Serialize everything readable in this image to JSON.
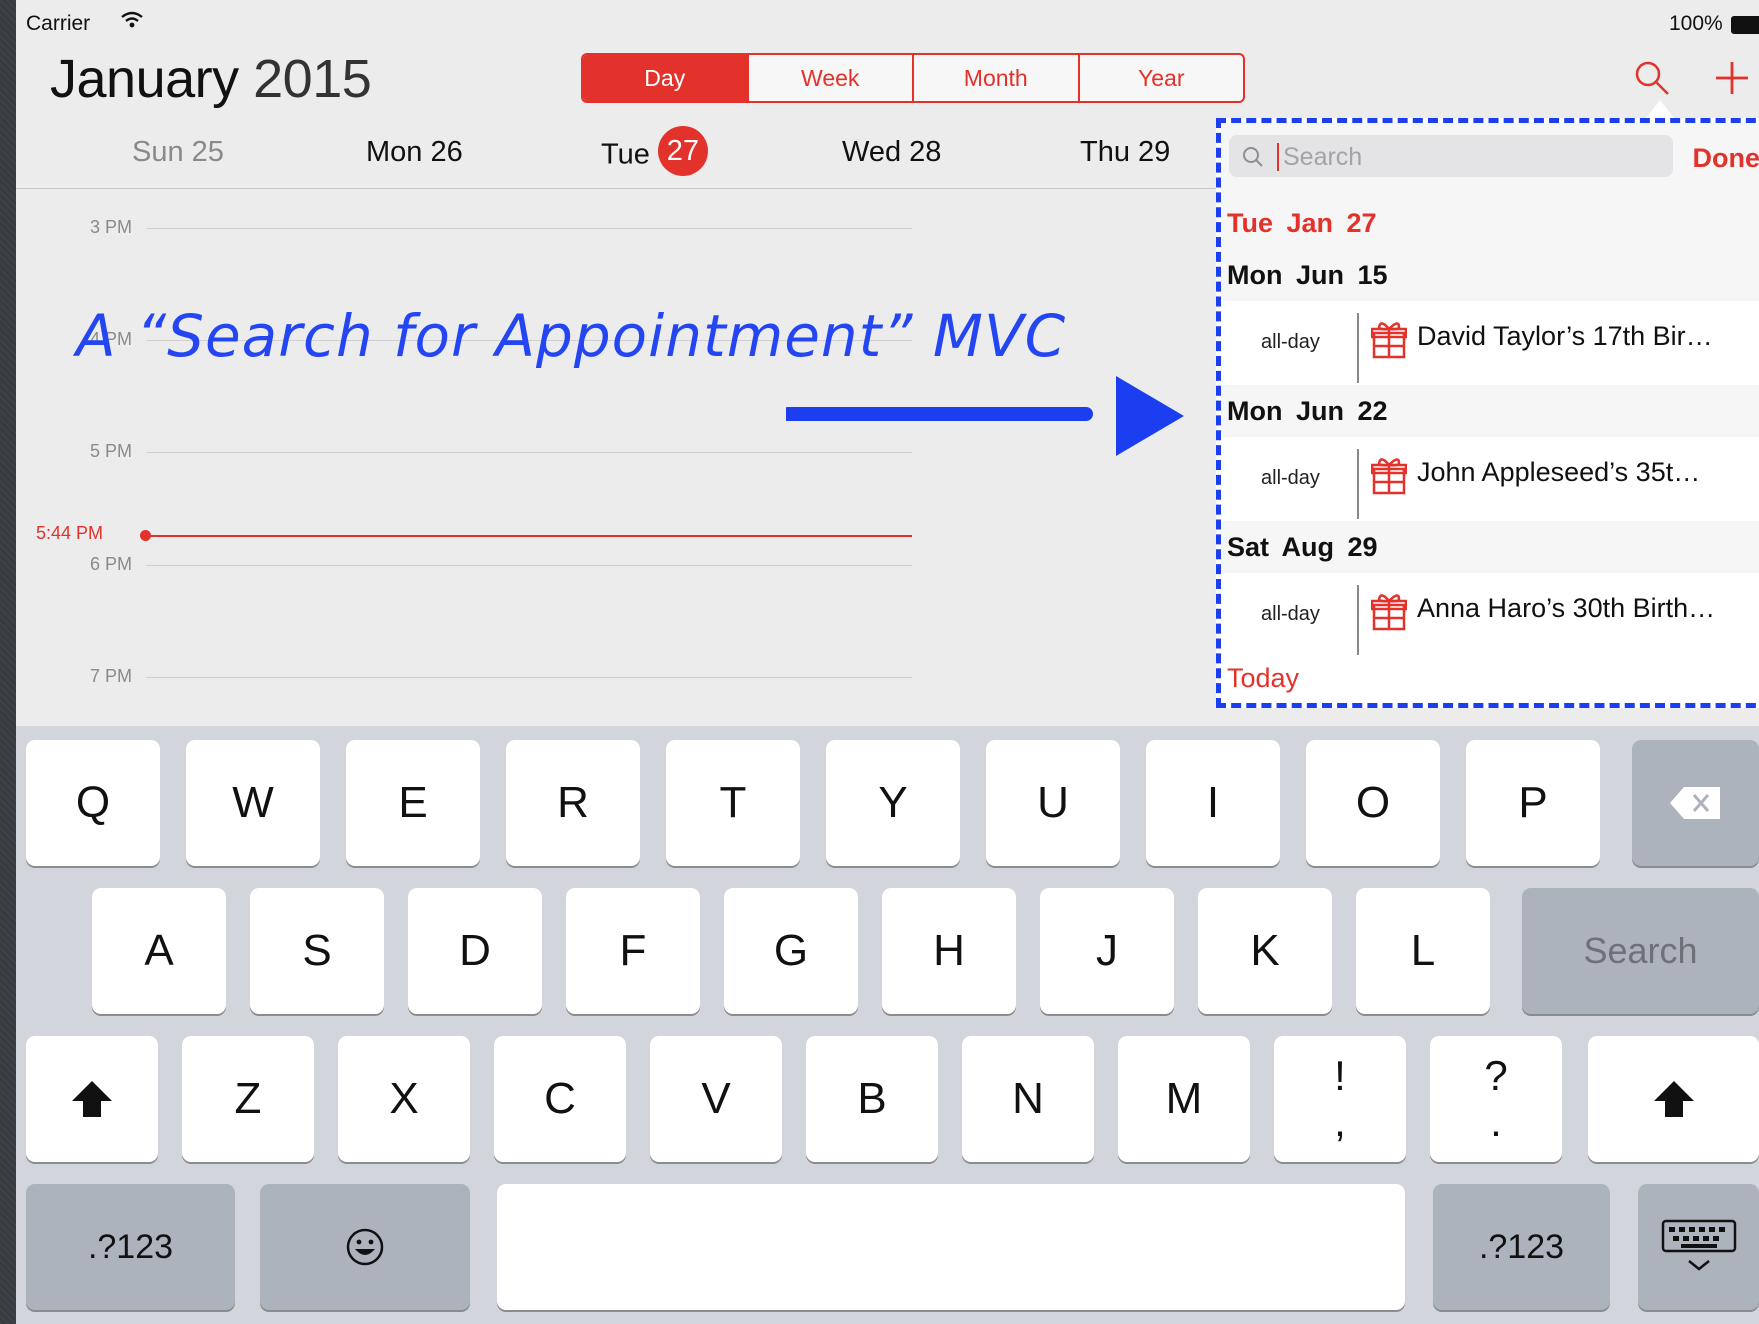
{
  "status_bar": {
    "carrier": "Carrier",
    "battery": "100%"
  },
  "header": {
    "month": "January",
    "year": "2015",
    "tabs": [
      {
        "label": "Day",
        "active": true
      },
      {
        "label": "Week",
        "active": false
      },
      {
        "label": "Month",
        "active": false
      },
      {
        "label": "Year",
        "active": false
      }
    ]
  },
  "week": [
    {
      "label": "Sun 25",
      "dim": true
    },
    {
      "label": "Mon 26",
      "dim": false
    },
    {
      "label": "Tue",
      "badge": "27",
      "dim": false
    },
    {
      "label": "Wed 28",
      "dim": false
    },
    {
      "label": "Thu 29",
      "dim": false
    }
  ],
  "timeline": {
    "hours": [
      "3 PM",
      "4 PM",
      "5 PM",
      "6 PM",
      "7 PM"
    ],
    "now": "5:44 PM"
  },
  "annotation": "A “Search for Appointment” MVC",
  "popover": {
    "search_placeholder": "Search",
    "done_label": "Done",
    "current_date": "Tue  Jan 27",
    "sections": [
      {
        "date": "Mon  Jun 15",
        "allday": "all-day",
        "title": "David Taylor’s 17th Bir…"
      },
      {
        "date": "Mon  Jun 22",
        "allday": "all-day",
        "title": "John Appleseed’s 35t…"
      },
      {
        "date": "Sat  Aug 29",
        "allday": "all-day",
        "title": "Anna Haro’s 30th Birth…"
      }
    ],
    "today_label": "Today"
  },
  "keyboard": {
    "row1": [
      "Q",
      "W",
      "E",
      "R",
      "T",
      "Y",
      "U",
      "I",
      "O",
      "P"
    ],
    "row2": [
      "A",
      "S",
      "D",
      "F",
      "G",
      "H",
      "J",
      "K",
      "L"
    ],
    "search_key": "Search",
    "row3": [
      "Z",
      "X",
      "C",
      "V",
      "B",
      "N",
      "M"
    ],
    "punct1_top": "!",
    "punct1_bottom": ",",
    "punct2_top": "?",
    "punct2_bottom": ".",
    "num_key": ".?123"
  },
  "colors": {
    "accent": "#e3322b",
    "annotation": "#2446f2",
    "keyboard_bg": "#d2d5db"
  }
}
